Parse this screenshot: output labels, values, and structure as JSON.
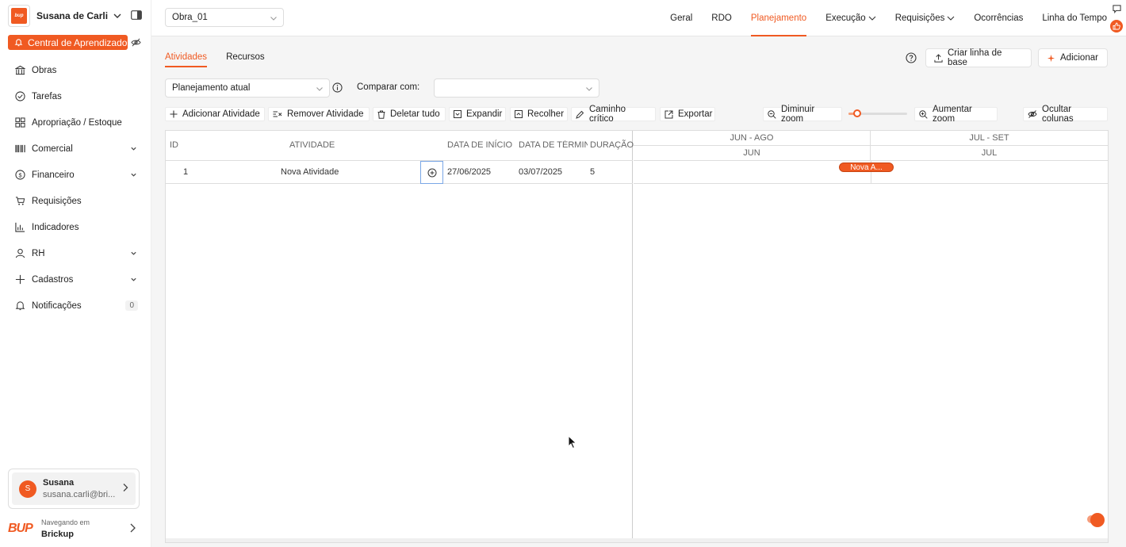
{
  "workspace": {
    "user_name": "Susana de Carli"
  },
  "sidebar": {
    "central_label": "Central de Aprendizado",
    "items": [
      {
        "label": "Obras",
        "icon": "building-icon"
      },
      {
        "label": "Tarefas",
        "icon": "check-circle-icon"
      },
      {
        "label": "Apropriação / Estoque",
        "icon": "grid-icon"
      },
      {
        "label": "Comercial",
        "icon": "barcode-icon"
      },
      {
        "label": "Financeiro",
        "icon": "dollar-icon"
      },
      {
        "label": "Requisições",
        "icon": "cart-icon"
      },
      {
        "label": "Indicadores",
        "icon": "bar-chart-icon"
      },
      {
        "label": "RH",
        "icon": "person-icon"
      },
      {
        "label": "Cadastros",
        "icon": "plus-icon"
      },
      {
        "label": "Notificações",
        "icon": "bell-icon",
        "badge": "0"
      }
    ],
    "user_card": {
      "initial": "S",
      "name": "Susana",
      "email": "susana.carli@bri..."
    },
    "footer": {
      "brand": "BUP",
      "sub": "Navegando em",
      "org": "Brickup"
    }
  },
  "header": {
    "project": "Obra_01",
    "nav": [
      "Geral",
      "RDO",
      "Planejamento",
      "Execução",
      "Requisições",
      "Ocorrências",
      "Linha do Tempo"
    ],
    "active": "Planejamento"
  },
  "subtabs": [
    "Atividades",
    "Recursos"
  ],
  "actions": {
    "baseline": "Criar linha de base",
    "add": "Adicionar"
  },
  "filters": {
    "plan": "Planejamento atual",
    "compare_label": "Comparar com:",
    "compare_value": ""
  },
  "toolbar": {
    "add_activity": "Adicionar Atividade",
    "remove_activity": "Remover Atividade",
    "delete_all": "Deletar tudo",
    "expand": "Expandir",
    "collapse": "Recolher",
    "critical_path": "Caminho crítico",
    "export": "Exportar",
    "zoom_out": "Diminuir zoom",
    "zoom_in": "Aumentar zoom",
    "zoom_level": 0.15,
    "hide_columns": "Ocultar colunas"
  },
  "grid": {
    "columns": [
      "ID",
      "ATIVIDADE",
      "DATA DE INÍCIO",
      "DATA DE TÉRMIN",
      "DURAÇÃO"
    ],
    "rows": [
      {
        "id": "1",
        "activity": "Nova Atividade",
        "start": "27/06/2025",
        "end": "03/07/2025",
        "duration": "5"
      }
    ]
  },
  "gantt": {
    "top_headers": [
      "JUN - AGO",
      "JUL - SET"
    ],
    "sub_headers": [
      "JUN",
      "JUL"
    ],
    "bar_label": "Nova A..."
  },
  "colors": {
    "accent": "#f05a22"
  }
}
